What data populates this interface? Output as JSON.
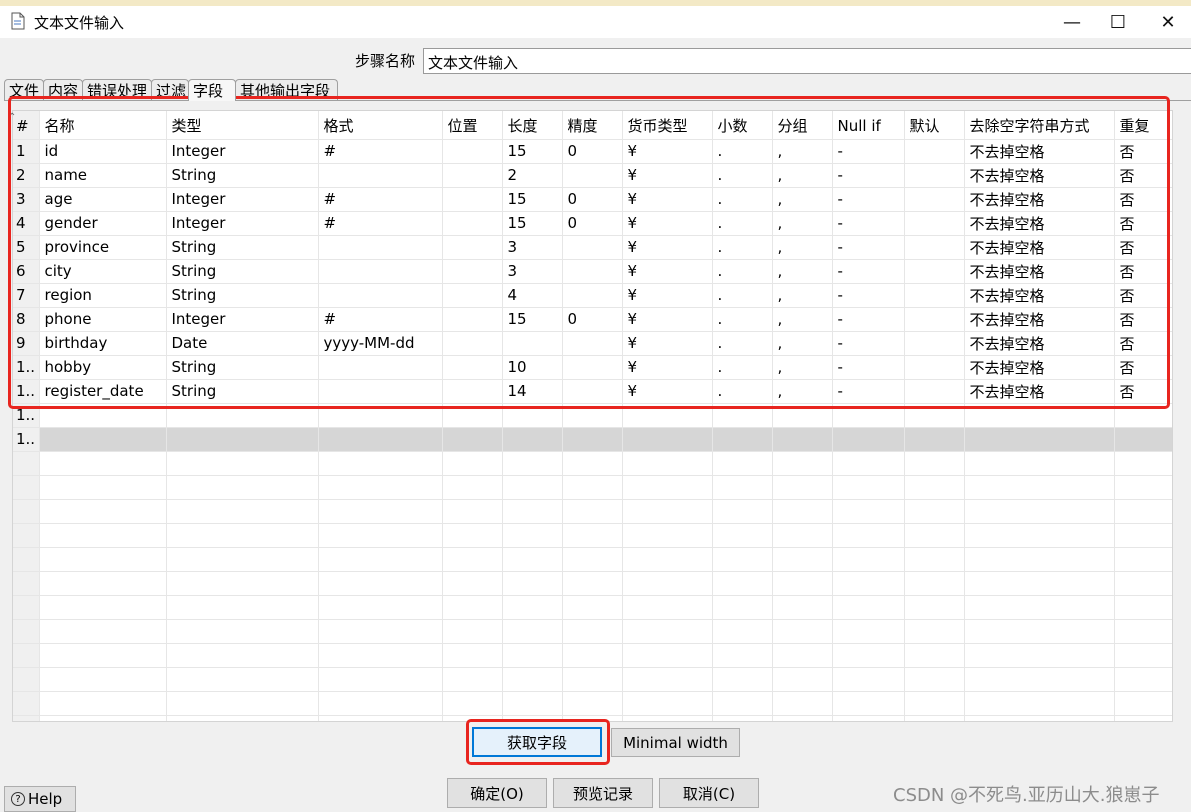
{
  "window": {
    "title": "文本文件输入",
    "minimize_glyph": "—",
    "maximize_glyph": "☐",
    "close_glyph": "✕"
  },
  "step": {
    "label": "步骤名称",
    "value": "文本文件输入"
  },
  "tabs": [
    {
      "label": "文件"
    },
    {
      "label": "内容"
    },
    {
      "label": "错误处理"
    },
    {
      "label": "过滤"
    },
    {
      "label": "字段"
    },
    {
      "label": "其他输出字段"
    }
  ],
  "columns": [
    "#",
    "名称",
    "类型",
    "格式",
    "位置",
    "长度",
    "精度",
    "货币类型",
    "小数",
    "分组",
    "Null if",
    "默认",
    "去除空字符串方式",
    "重复"
  ],
  "rows": [
    [
      "1",
      "id",
      "Integer",
      "#",
      "",
      "15",
      "0",
      "¥",
      ".",
      ",",
      "-",
      "",
      "不去掉空格",
      "否"
    ],
    [
      "2",
      "name",
      "String",
      "",
      "",
      "2",
      "",
      "¥",
      ".",
      ",",
      "-",
      "",
      "不去掉空格",
      "否"
    ],
    [
      "3",
      "age",
      "Integer",
      "#",
      "",
      "15",
      "0",
      "¥",
      ".",
      ",",
      "-",
      "",
      "不去掉空格",
      "否"
    ],
    [
      "4",
      "gender",
      "Integer",
      "#",
      "",
      "15",
      "0",
      "¥",
      ".",
      ",",
      "-",
      "",
      "不去掉空格",
      "否"
    ],
    [
      "5",
      "province",
      "String",
      "",
      "",
      "3",
      "",
      "¥",
      ".",
      ",",
      "-",
      "",
      "不去掉空格",
      "否"
    ],
    [
      "6",
      "city",
      "String",
      "",
      "",
      "3",
      "",
      "¥",
      ".",
      ",",
      "-",
      "",
      "不去掉空格",
      "否"
    ],
    [
      "7",
      "region",
      "String",
      "",
      "",
      "4",
      "",
      "¥",
      ".",
      ",",
      "-",
      "",
      "不去掉空格",
      "否"
    ],
    [
      "8",
      "phone",
      "Integer",
      "#",
      "",
      "15",
      "0",
      "¥",
      ".",
      ",",
      "-",
      "",
      "不去掉空格",
      "否"
    ],
    [
      "9",
      "birthday",
      "Date",
      "yyyy-MM-dd",
      "",
      "",
      "",
      "¥",
      ".",
      ",",
      "-",
      "",
      "不去掉空格",
      "否"
    ],
    [
      "1..",
      "hobby",
      "String",
      "",
      "",
      "10",
      "",
      "¥",
      ".",
      ",",
      "-",
      "",
      "不去掉空格",
      "否"
    ],
    [
      "1..",
      "register_date",
      "String",
      "",
      "",
      "14",
      "",
      "¥",
      ".",
      ",",
      "-",
      "",
      "不去掉空格",
      "否"
    ],
    [
      "1..",
      "",
      "",
      "",
      "",
      "",
      "",
      "",
      "",
      "",
      "",
      "",
      "",
      ""
    ],
    [
      "1..",
      "",
      "",
      "",
      "",
      "",
      "",
      "",
      "",
      "",
      "",
      "",
      "",
      ""
    ]
  ],
  "selected_row": 12,
  "buttons": {
    "get_fields": "获取字段",
    "minimal_width": "Minimal width",
    "ok": "确定(O)",
    "preview": "预览记录",
    "cancel": "取消(C)",
    "help": "Help"
  },
  "help_icon_glyph": "?",
  "sort_glyph": "⌃",
  "watermark": "CSDN @不死鸟.亚历山大.狼崽子",
  "colors": {
    "highlight": "#e8251f",
    "selected_row": "#d6d6d6",
    "focus": "#0078d7"
  }
}
